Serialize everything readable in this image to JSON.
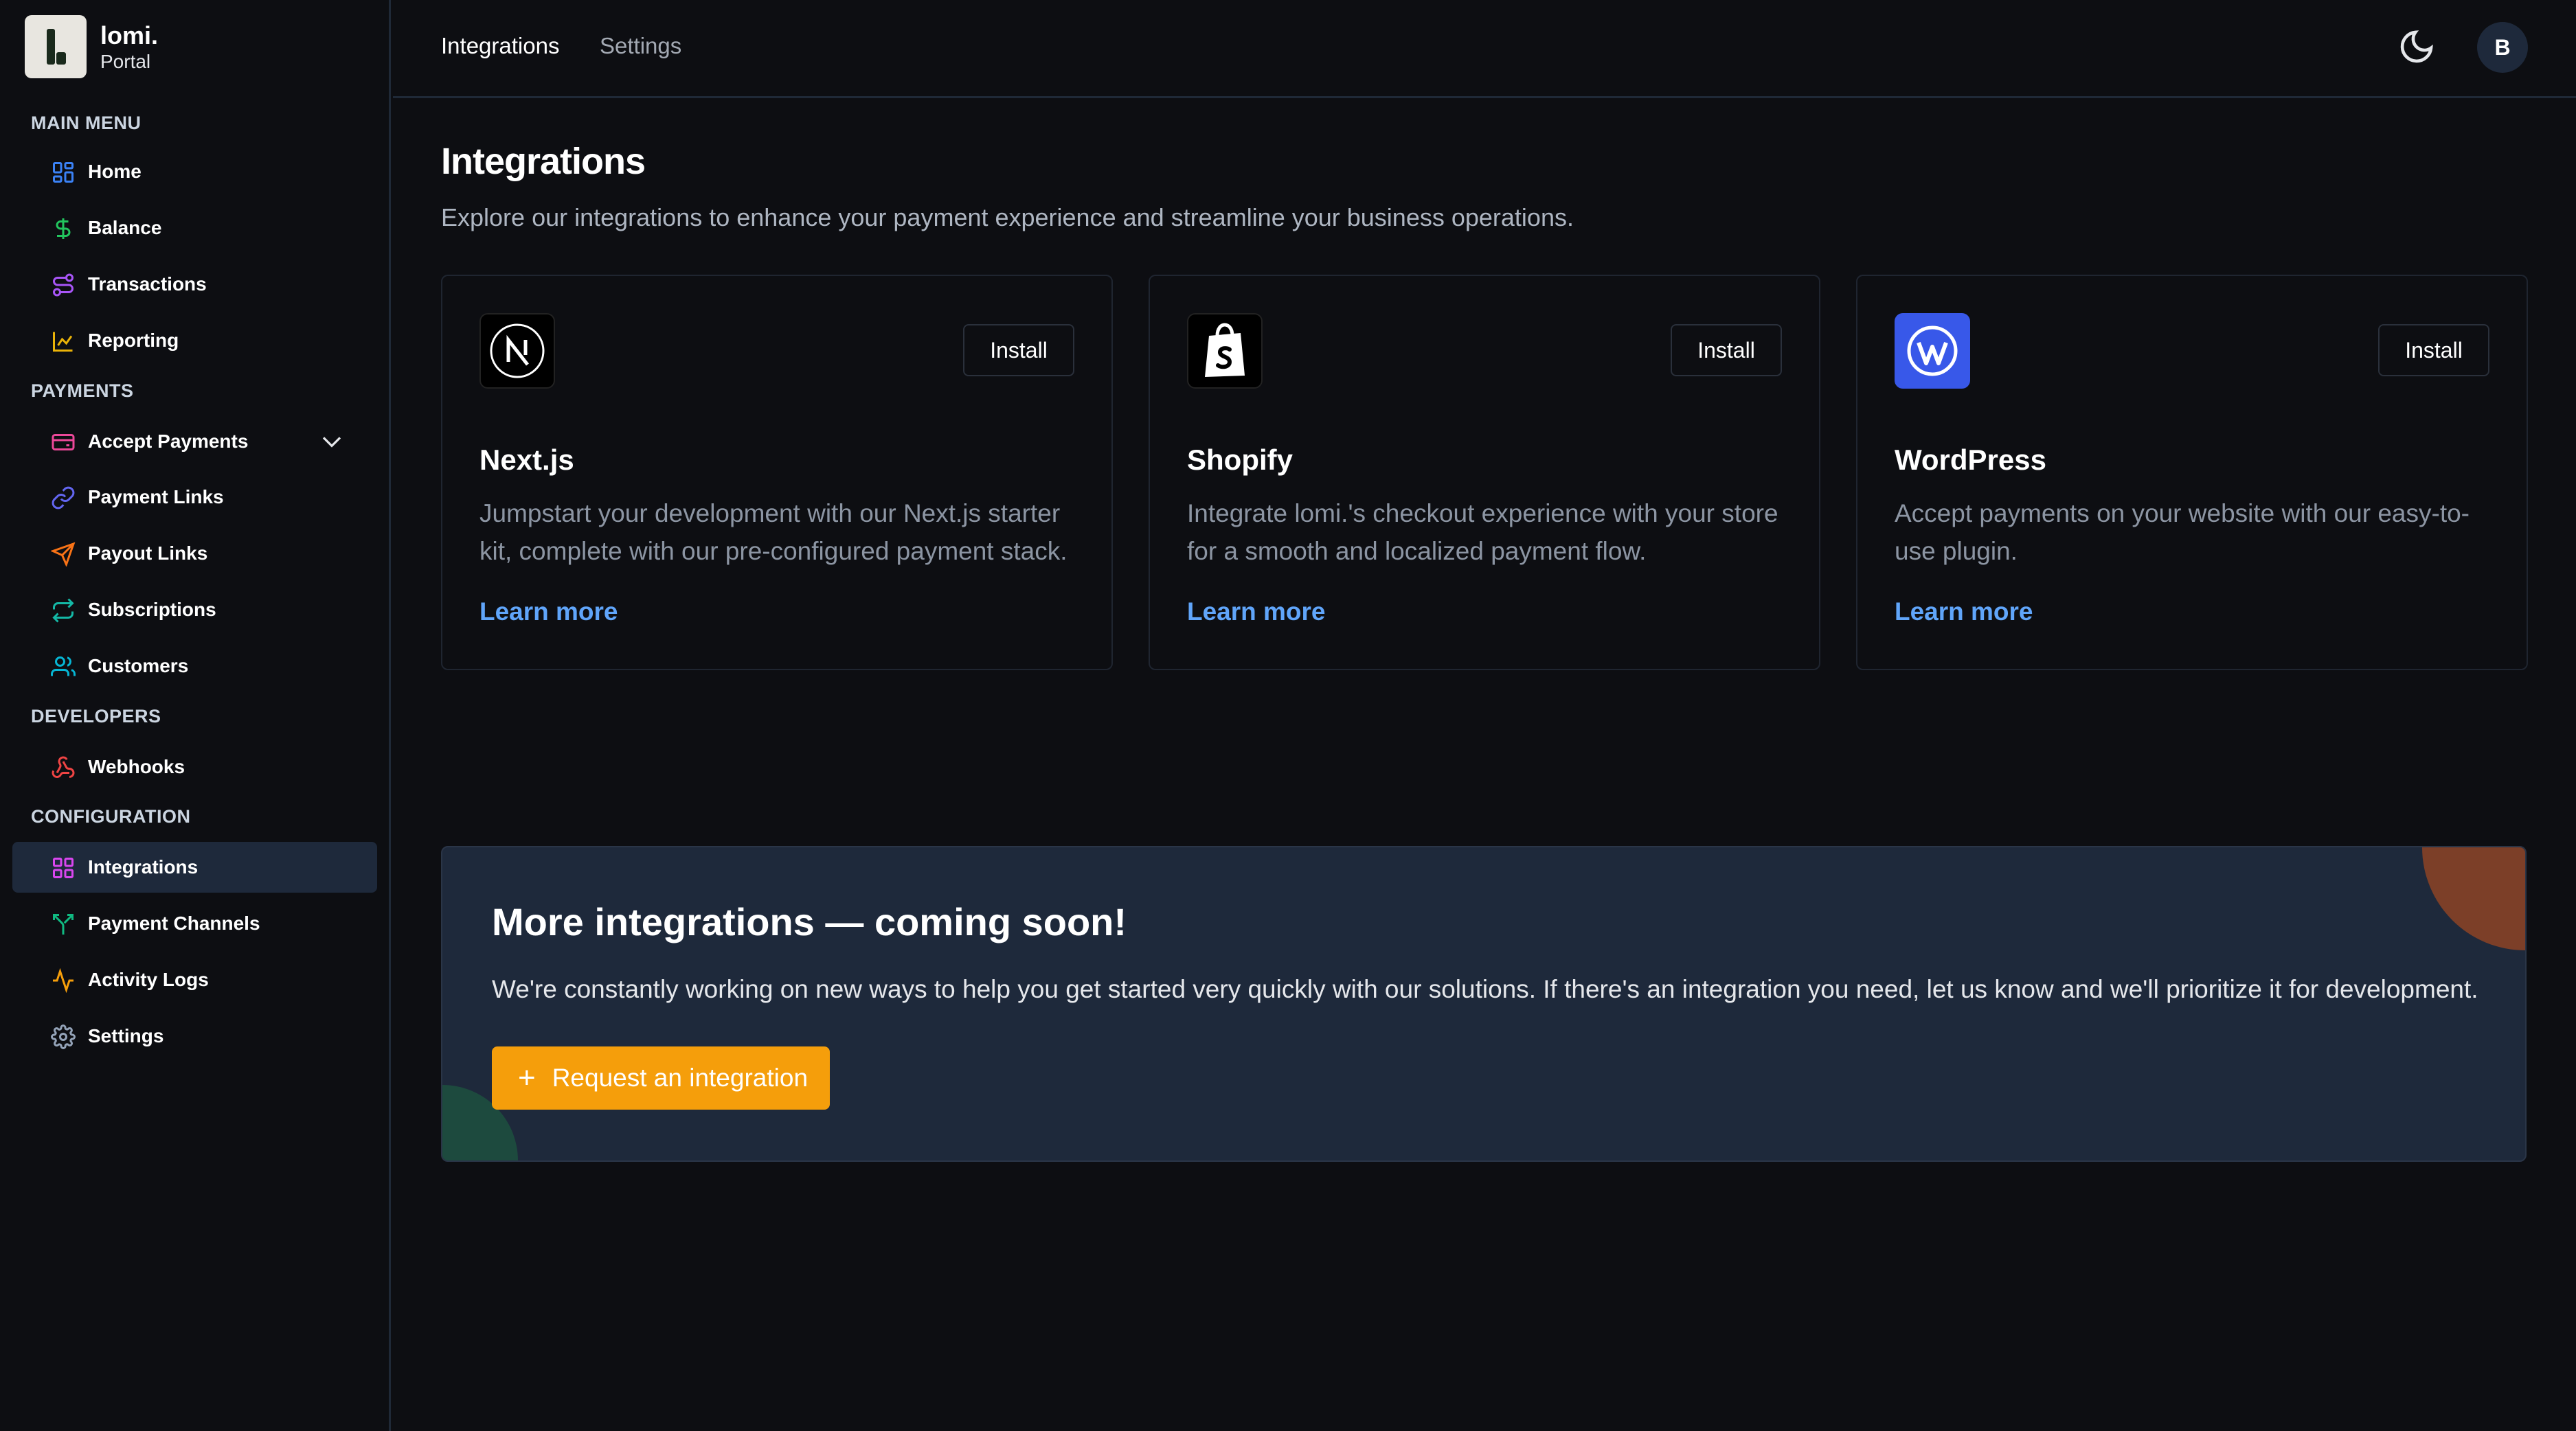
{
  "brand": {
    "name": "lomi.",
    "subtitle": "Portal"
  },
  "sidebar": {
    "sections": {
      "main_menu": "MAIN MENU",
      "payments": "PAYMENTS",
      "developers": "DEVELOPERS",
      "configuration": "CONFIGURATION"
    },
    "items": [
      {
        "label": "Home",
        "icon": "grid-icon",
        "color": "#3b82f6"
      },
      {
        "label": "Balance",
        "icon": "dollar-icon",
        "color": "#22c55e"
      },
      {
        "label": "Transactions",
        "icon": "transfer-icon",
        "color": "#a855f7"
      },
      {
        "label": "Reporting",
        "icon": "chart-icon",
        "color": "#eab308"
      },
      {
        "label": "Accept Payments",
        "icon": "card-icon",
        "color": "#ec4899"
      },
      {
        "label": "Payment Links",
        "icon": "link-icon",
        "color": "#6366f1"
      },
      {
        "label": "Payout Links",
        "icon": "send-icon",
        "color": "#f97316"
      },
      {
        "label": "Subscriptions",
        "icon": "repeat-icon",
        "color": "#14b8a6"
      },
      {
        "label": "Customers",
        "icon": "users-icon",
        "color": "#06b6d4"
      },
      {
        "label": "Webhooks",
        "icon": "webhook-icon",
        "color": "#ef4444"
      },
      {
        "label": "Integrations",
        "icon": "blocks-icon",
        "color": "#d946ef",
        "active": true
      },
      {
        "label": "Payment Channels",
        "icon": "split-icon",
        "color": "#10b981"
      },
      {
        "label": "Activity Logs",
        "icon": "activity-icon",
        "color": "#f59e0b"
      },
      {
        "label": "Settings",
        "icon": "gear-icon",
        "color": "#94a3b8"
      }
    ]
  },
  "topbar": {
    "tabs": [
      {
        "label": "Integrations",
        "active": true
      },
      {
        "label": "Settings",
        "active": false
      }
    ],
    "avatar_initial": "B"
  },
  "main": {
    "title": "Integrations",
    "subtitle": "Explore our integrations to enhance your payment experience and streamline your business operations.",
    "cards": [
      {
        "name": "Next.js",
        "logo": "nextjs-logo",
        "install_label": "Install",
        "description": "Jumpstart your development with our Next.js starter kit, complete with our pre-configured payment stack.",
        "link_label": "Learn more"
      },
      {
        "name": "Shopify",
        "logo": "shopify-logo",
        "install_label": "Install",
        "description": "Integrate lomi.'s checkout experience with your store for a smooth and localized payment flow.",
        "link_label": "Learn more"
      },
      {
        "name": "WordPress",
        "logo": "wordpress-logo",
        "install_label": "Install",
        "description": "Accept payments on your website with our easy-to-use plugin.",
        "link_label": "Learn more"
      }
    ],
    "banner": {
      "title": "More integrations — coming soon!",
      "text": "We're constantly working on new ways to help you get started very quickly with our solutions. If there's an integration you need, let us know and we'll prioritize it for development.",
      "button_label": "Request an integration",
      "button_color": "#f59e0b"
    }
  },
  "colors": {
    "background": "#0d0e12",
    "accent_link": "#60a5fa",
    "wordpress": "#3858e9"
  }
}
